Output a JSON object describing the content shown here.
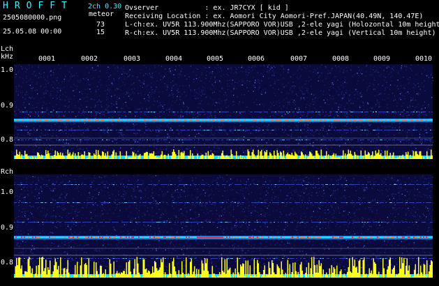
{
  "header": {
    "brand": "HROFFT",
    "version": "2ch 0.30",
    "filename": "2505080000.png",
    "meteor_label": "meteor",
    "datetime": "25.05.08 00:00",
    "count_l": "73",
    "count_r": "15",
    "observer_line": "Ovserver           : ex. JR7CYX [ kid ]",
    "location_line": "Receiving Location : ex. Aomori City Aomori-Pref.JAPAN(40.49N, 140.47E)",
    "lch_line": "L-ch:ex. UV5R 113.900Mhz(SAPPORO VOR)USB ,2-ele yagi (Holozontal 10m height)",
    "rch_line": "R-ch:ex. UV5R 113.900Mhz(SAPPORO VOR)USB ,2-ele yagi (Vertical 10m height)"
  },
  "left_panel": {
    "channel_label": "Lch",
    "unit_label": "kHz",
    "freq_ticks": [
      "1.0",
      "0.9",
      "0.8"
    ]
  },
  "right_panel": {
    "channel_label": "Rch",
    "freq_ticks": [
      "1.0",
      "0.9",
      "0.8"
    ]
  },
  "time_markers": [
    "0001",
    "0002",
    "0003",
    "0004",
    "0005",
    "0006",
    "0007",
    "0008",
    "0009",
    "0010"
  ],
  "colors": {
    "background": "#000000",
    "text_cyan": "#3ef0ff",
    "spectrogram_bg": "#0a0a3c",
    "signal_line": "#ff3030",
    "meteor_bars": "#ffff20",
    "baseline": "#00e5ff"
  }
}
